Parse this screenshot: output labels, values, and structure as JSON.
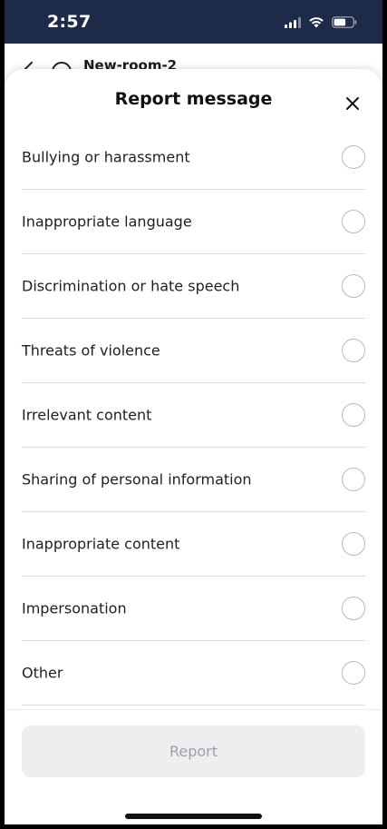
{
  "status_bar": {
    "time": "2:57"
  },
  "background": {
    "room_title": "New-room-2"
  },
  "sheet": {
    "title": "Report message",
    "options": [
      {
        "label": "Bullying or harassment"
      },
      {
        "label": "Inappropriate language"
      },
      {
        "label": "Discrimination or hate speech"
      },
      {
        "label": "Threats of violence"
      },
      {
        "label": "Irrelevant content"
      },
      {
        "label": "Sharing of personal information"
      },
      {
        "label": "Inappropriate content"
      },
      {
        "label": "Impersonation"
      },
      {
        "label": "Other"
      }
    ],
    "report_label": "Report"
  },
  "icons": {
    "close": "close-icon",
    "signal": "cellular-signal-icon",
    "wifi": "wifi-icon",
    "battery": "battery-icon"
  },
  "colors": {
    "status_bar": "#1d2a48",
    "disabled_button_bg": "#eeeeef",
    "disabled_button_text": "#9aa0ab",
    "radio_border": "#b9b9b9",
    "divider": "#dcdcdc"
  }
}
